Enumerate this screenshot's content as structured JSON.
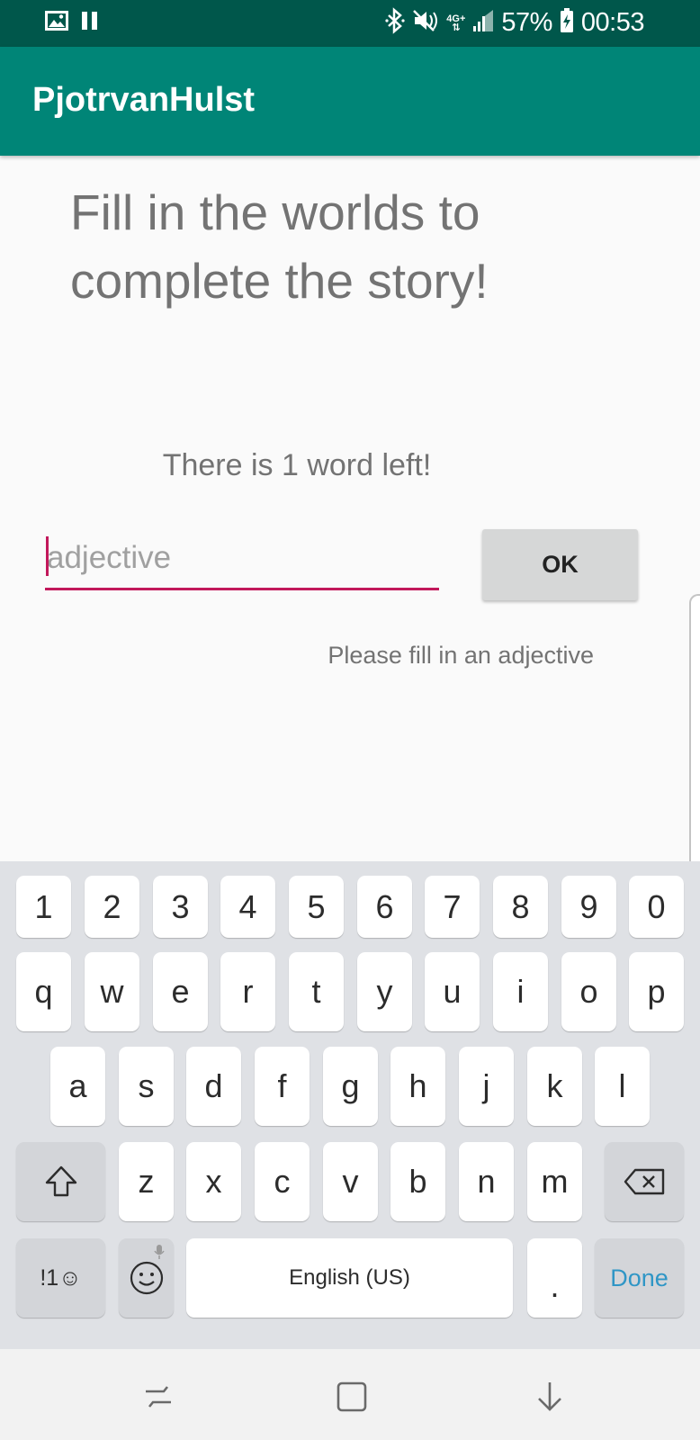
{
  "status_bar": {
    "battery": "57%",
    "time": "00:53",
    "network": "4G+",
    "icons": [
      "gallery-icon",
      "pause-icon",
      "bluetooth-icon",
      "mute-icon",
      "network-icon",
      "signal-icon",
      "battery-icon"
    ]
  },
  "app": {
    "title": "PjotrvanHulst"
  },
  "main": {
    "heading": "Fill in the worlds to complete the story!",
    "words_left": "There is 1 word left!",
    "input": {
      "placeholder": "adjective",
      "value": ""
    },
    "ok_label": "OK",
    "hint": "Please fill in an adjective"
  },
  "keyboard": {
    "number_row": [
      "1",
      "2",
      "3",
      "4",
      "5",
      "6",
      "7",
      "8",
      "9",
      "0"
    ],
    "row1": [
      "q",
      "w",
      "e",
      "r",
      "t",
      "y",
      "u",
      "i",
      "o",
      "p"
    ],
    "row2": [
      "a",
      "s",
      "d",
      "f",
      "g",
      "h",
      "j",
      "k",
      "l"
    ],
    "row3": [
      "z",
      "x",
      "c",
      "v",
      "b",
      "n",
      "m"
    ],
    "symbols_label": "!1☺",
    "space_label": "English (US)",
    "period_label": ".",
    "done_label": "Done",
    "icons": [
      "shift-icon",
      "backspace-icon",
      "emoji-icon",
      "mic-icon"
    ]
  },
  "nav_bar": {
    "icons": [
      "recent-apps-icon",
      "home-icon",
      "back-icon"
    ]
  },
  "colors": {
    "status_bar": "#00574b",
    "toolbar": "#008577",
    "accent": "#c2185b",
    "done_text": "#2f96c6"
  }
}
